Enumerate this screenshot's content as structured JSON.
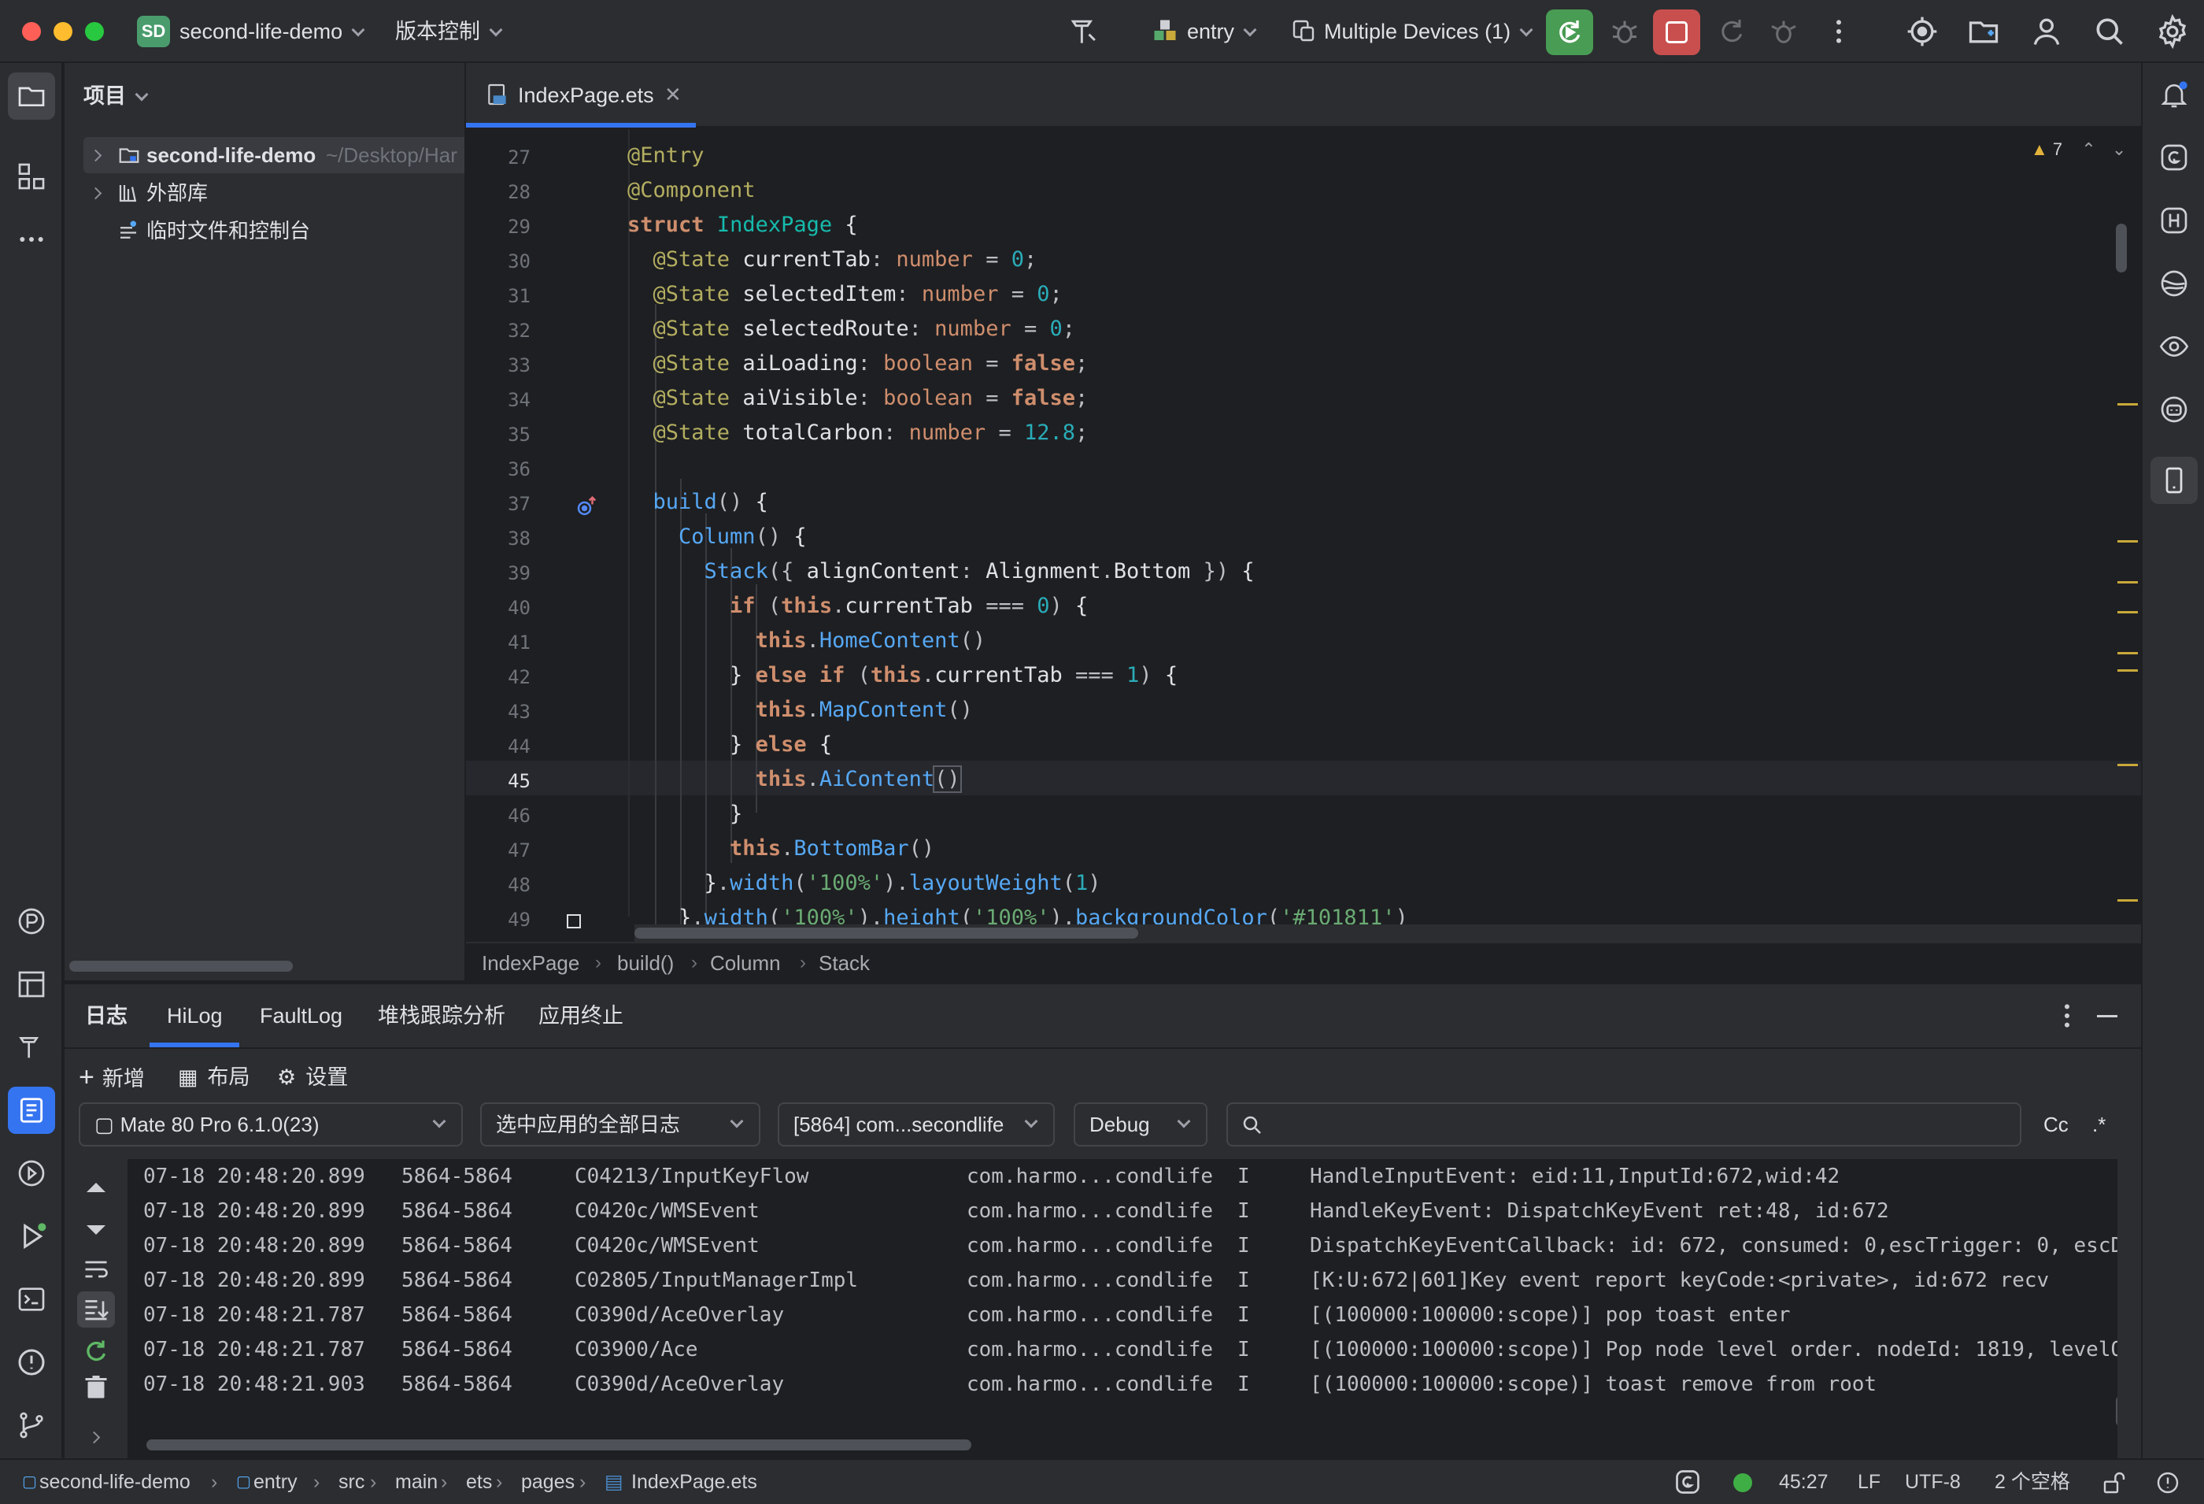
{
  "titlebar": {
    "project_badge": "SD",
    "project_name": "second-life-demo",
    "vcs": "版本控制",
    "run_config": "entry",
    "device": "Multiple Devices (1)"
  },
  "project_panel": {
    "title": "项目",
    "tree": [
      {
        "label": "second-life-demo",
        "path": "~/Desktop/Har"
      },
      {
        "label": "外部库"
      },
      {
        "label": "临时文件和控制台"
      }
    ]
  },
  "editor": {
    "tab_label": "IndexPage.ets",
    "warnings": "7",
    "first_line": 27,
    "current_line": 45,
    "breadcrumbs": [
      "IndexPage",
      "build()",
      "Column",
      "Stack"
    ]
  },
  "log": {
    "tabs": [
      "日志",
      "HiLog",
      "FaultLog",
      "堆栈跟踪分析",
      "应用终止"
    ],
    "active_tab": "HiLog",
    "toolbar": {
      "add": "新增",
      "layout": "布局",
      "settings": "设置"
    },
    "filters": {
      "device": "Mate 80 Pro 6.1.0(23)",
      "scope": "选中应用的全部日志",
      "process": "[5864] com...secondlife",
      "level": "Debug",
      "search_placeholder": "",
      "case": "Cc",
      "regex": ".*"
    },
    "rows": [
      {
        "time": "07-18 20:48:20.899",
        "pid": "5864-5864",
        "tag": "C04213/InputKeyFlow",
        "pkg": "com.harmo...condlife",
        "lvl": "I",
        "msg": "HandleInputEvent: eid:11,InputId:672,wid:42"
      },
      {
        "time": "07-18 20:48:20.899",
        "pid": "5864-5864",
        "tag": "C0420c/WMSEvent",
        "pkg": "com.harmo...condlife",
        "lvl": "I",
        "msg": "HandleKeyEvent: DispatchKeyEvent ret:48, id:672"
      },
      {
        "time": "07-18 20:48:20.899",
        "pid": "5864-5864",
        "tag": "C0420c/WMSEvent",
        "pkg": "com.harmo...condlife",
        "lvl": "I",
        "msg": "DispatchKeyEventCallback: id: 672, consumed: 0,escTrigger: 0, escD"
      },
      {
        "time": "07-18 20:48:20.899",
        "pid": "5864-5864",
        "tag": "C02805/InputManagerImpl",
        "pkg": "com.harmo...condlife",
        "lvl": "I",
        "msg": "[K:U:672|601]Key event report keyCode:<private>, id:672 recv"
      },
      {
        "time": "07-18 20:48:21.787",
        "pid": "5864-5864",
        "tag": "C0390d/AceOverlay",
        "pkg": "com.harmo...condlife",
        "lvl": "I",
        "msg": "[(100000:100000:scope)] pop toast enter"
      },
      {
        "time": "07-18 20:48:21.787",
        "pid": "5864-5864",
        "tag": "C03900/Ace",
        "pkg": "com.harmo...condlife",
        "lvl": "I",
        "msg": "[(100000:100000:scope)] Pop node level order. nodeId: 1819, levelO"
      },
      {
        "time": "07-18 20:48:21.903",
        "pid": "5864-5864",
        "tag": "C0390d/AceOverlay",
        "pkg": "com.harmo...condlife",
        "lvl": "I",
        "msg": "[(100000:100000:scope)] toast remove from root"
      }
    ]
  },
  "statusbar": {
    "path": [
      "second-life-demo",
      "entry",
      "src",
      "main",
      "ets",
      "pages",
      "IndexPage.ets"
    ],
    "position": "45:27",
    "line_sep": "LF",
    "encoding": "UTF-8",
    "indent": "2 个空格"
  },
  "colors": {
    "accent": "#3574f0",
    "run_green": "#499c54",
    "stop_red": "#c94f4f"
  }
}
